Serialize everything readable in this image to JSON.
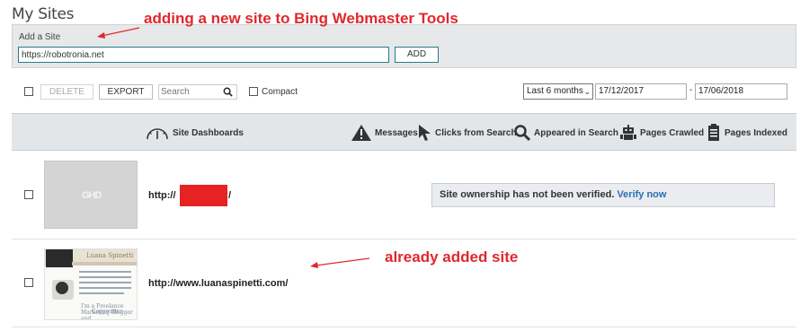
{
  "page": {
    "title": "My Sites"
  },
  "add_site": {
    "label": "Add a Site",
    "input_value": "https://robotronia.net",
    "button_label": "ADD"
  },
  "annotations": {
    "top": "adding a new site to Bing Webmaster Tools",
    "middle": "already added site",
    "color": "#e0282e"
  },
  "toolbar": {
    "delete_label": "DELETE",
    "export_label": "EXPORT",
    "search_placeholder": "Search",
    "compact_label": "Compact",
    "range_value": "Last 6 months",
    "date_from": "17/12/2017",
    "date_separator": "-",
    "date_to": "17/06/2018"
  },
  "columns": {
    "site_dashboards": "Site Dashboards",
    "messages": "Messages",
    "clicks": "Clicks from Search",
    "appeared": "Appeared in Search",
    "pages_crawled": "Pages Crawled",
    "pages_indexed": "Pages Indexed"
  },
  "sites": [
    {
      "url_prefix": "http://",
      "url_suffix": "/",
      "thumbnail_text": "GHD",
      "notice": "Site ownership has not been verified.",
      "notice_link": "Verify now"
    },
    {
      "url": "http://www.luanaspinetti.com/",
      "thumbnail_title": "Luana Spinetti",
      "thumbnail_heading": "I'm a Freelance Marketing Blogger and",
      "thumbnail_heading2": "Copywriter"
    }
  ],
  "colors": {
    "accent": "#2b7a8a",
    "link": "#2a6fb3",
    "redaction": "#e62222",
    "header_bg": "#e3e6e9"
  }
}
